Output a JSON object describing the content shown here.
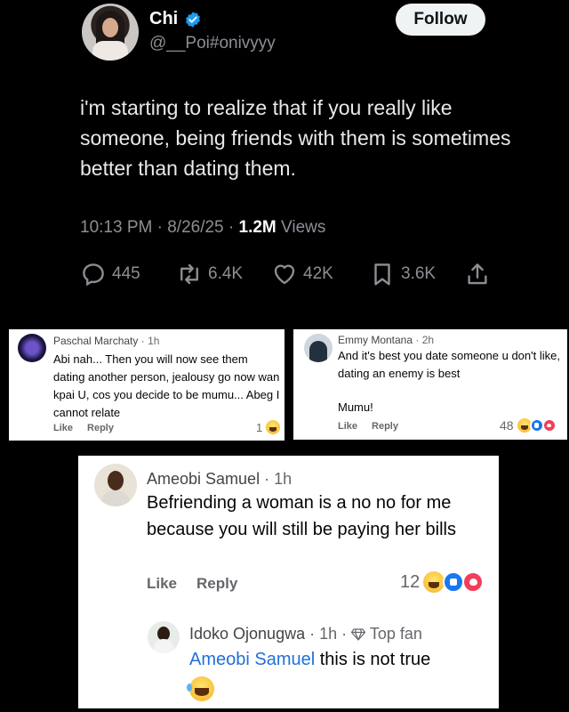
{
  "tweet": {
    "author_name": "Chi",
    "handle": "@__Poi#onivyyy",
    "follow_label": "Follow",
    "text": "i'm starting to realize that if you really like someone, being friends with them is sometimes better than dating them.",
    "time": "10:13 PM",
    "date": "8/26/25",
    "views_count": "1.2M",
    "views_label": "Views",
    "replies": "445",
    "reposts": "6.4K",
    "likes": "42K",
    "bookmarks": "3.6K"
  },
  "comments": [
    {
      "name": "Paschal Marchaty",
      "time": "1h",
      "text": "Abi nah... Then you will now see them dating another person, jealousy go now wan kpai U, cos you decide to be mumu... Abeg I cannot relate",
      "like_label": "Like",
      "reply_label": "Reply",
      "reaction_count": "1"
    },
    {
      "name": "Emmy Montana",
      "time": "2h",
      "text": "And it's best you date someone u don't like, dating an enemy is best",
      "text2": "Mumu!",
      "like_label": "Like",
      "reply_label": "Reply",
      "reaction_count": "48"
    },
    {
      "name": "Ameobi Samuel",
      "time": "1h",
      "text": "Befriending a woman is a no no for me because you will still be paying her bills",
      "like_label": "Like",
      "reply_label": "Reply",
      "reaction_count": "12",
      "reply": {
        "name": "Idoko Ojonugwa",
        "time": "1h",
        "badge": "Top fan",
        "mention": "Ameobi Samuel",
        "text": " this is not true"
      }
    }
  ],
  "colors": {
    "background": "#000000",
    "verified": "#1d9bf0",
    "mention": "#216fdb",
    "card": "#ffffff"
  }
}
